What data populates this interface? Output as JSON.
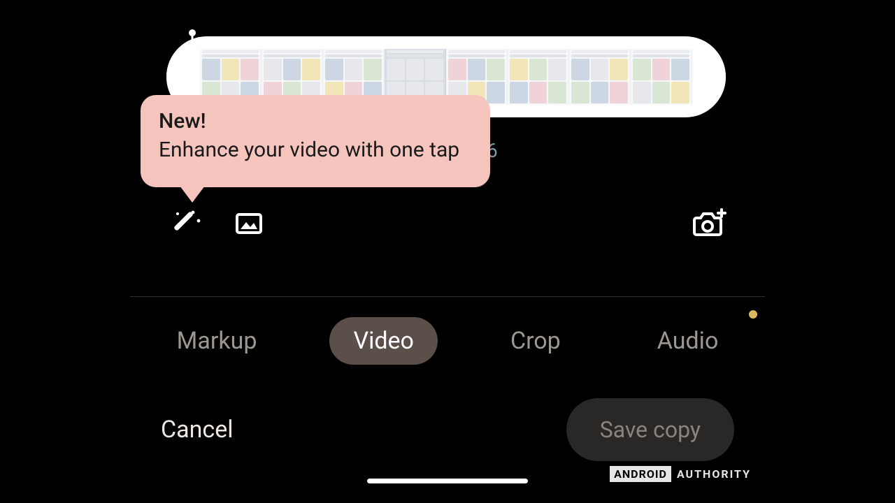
{
  "tooltip": {
    "title": "New!",
    "body": "Enhance your video with one tap"
  },
  "time_peek": "6",
  "icons": {
    "enhance": "magic-wand-icon",
    "frame": "frame-photo-icon",
    "export_frame": "camera-plus-icon"
  },
  "tabs": {
    "items": [
      {
        "label": "Markup",
        "active": false,
        "badge": false
      },
      {
        "label": "Video",
        "active": true,
        "badge": false
      },
      {
        "label": "Crop",
        "active": false,
        "badge": false
      },
      {
        "label": "Audio",
        "active": false,
        "badge": true
      }
    ]
  },
  "actions": {
    "cancel_label": "Cancel",
    "save_label": "Save copy"
  },
  "watermark": {
    "box": "ANDROID",
    "text": "AUTHORITY"
  }
}
